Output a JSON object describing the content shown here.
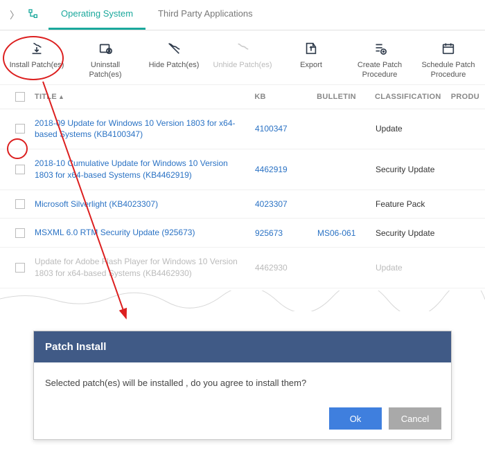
{
  "tabs": {
    "os": "Operating System",
    "tp": "Third Party Applications"
  },
  "toolbar": {
    "install": "Install Patch(es)",
    "uninstall": "Uninstall Patch(es)",
    "hide": "Hide Patch(es)",
    "unhide": "Unhide Patch(es)",
    "export": "Export",
    "create": "Create Patch Procedure",
    "schedule": "Schedule Patch Procedure"
  },
  "cols": {
    "title": "TITLE",
    "kb": "KB",
    "bulletin": "BULLETIN",
    "class": "CLASSIFICATION",
    "prod": "PRODU"
  },
  "rows": [
    {
      "title": "2018-09 Update for Windows 10 Version 1803 for x64-based Systems (KB4100347)",
      "kb": "4100347",
      "bulletin": "",
      "class": "Update"
    },
    {
      "title": "2018-10 Cumulative Update for Windows 10 Version 1803 for x64-based Systems (KB4462919)",
      "kb": "4462919",
      "bulletin": "",
      "class": "Security Update"
    },
    {
      "title": "Microsoft Silverlight (KB4023307)",
      "kb": "4023307",
      "bulletin": "",
      "class": "Feature Pack"
    },
    {
      "title": "MSXML 6.0 RTM Security Update (925673)",
      "kb": "925673",
      "bulletin": "MS06-061",
      "class": "Security Update"
    },
    {
      "title": "Update for Adobe Flash Player for Windows 10 Version 1803 for x64-based Systems (KB4462930)",
      "kb": "4462930",
      "bulletin": "",
      "class": "Update"
    }
  ],
  "dialog": {
    "title": "Patch Install",
    "body": "Selected patch(es) will be installed , do you agree to install them?",
    "ok": "Ok",
    "cancel": "Cancel"
  }
}
